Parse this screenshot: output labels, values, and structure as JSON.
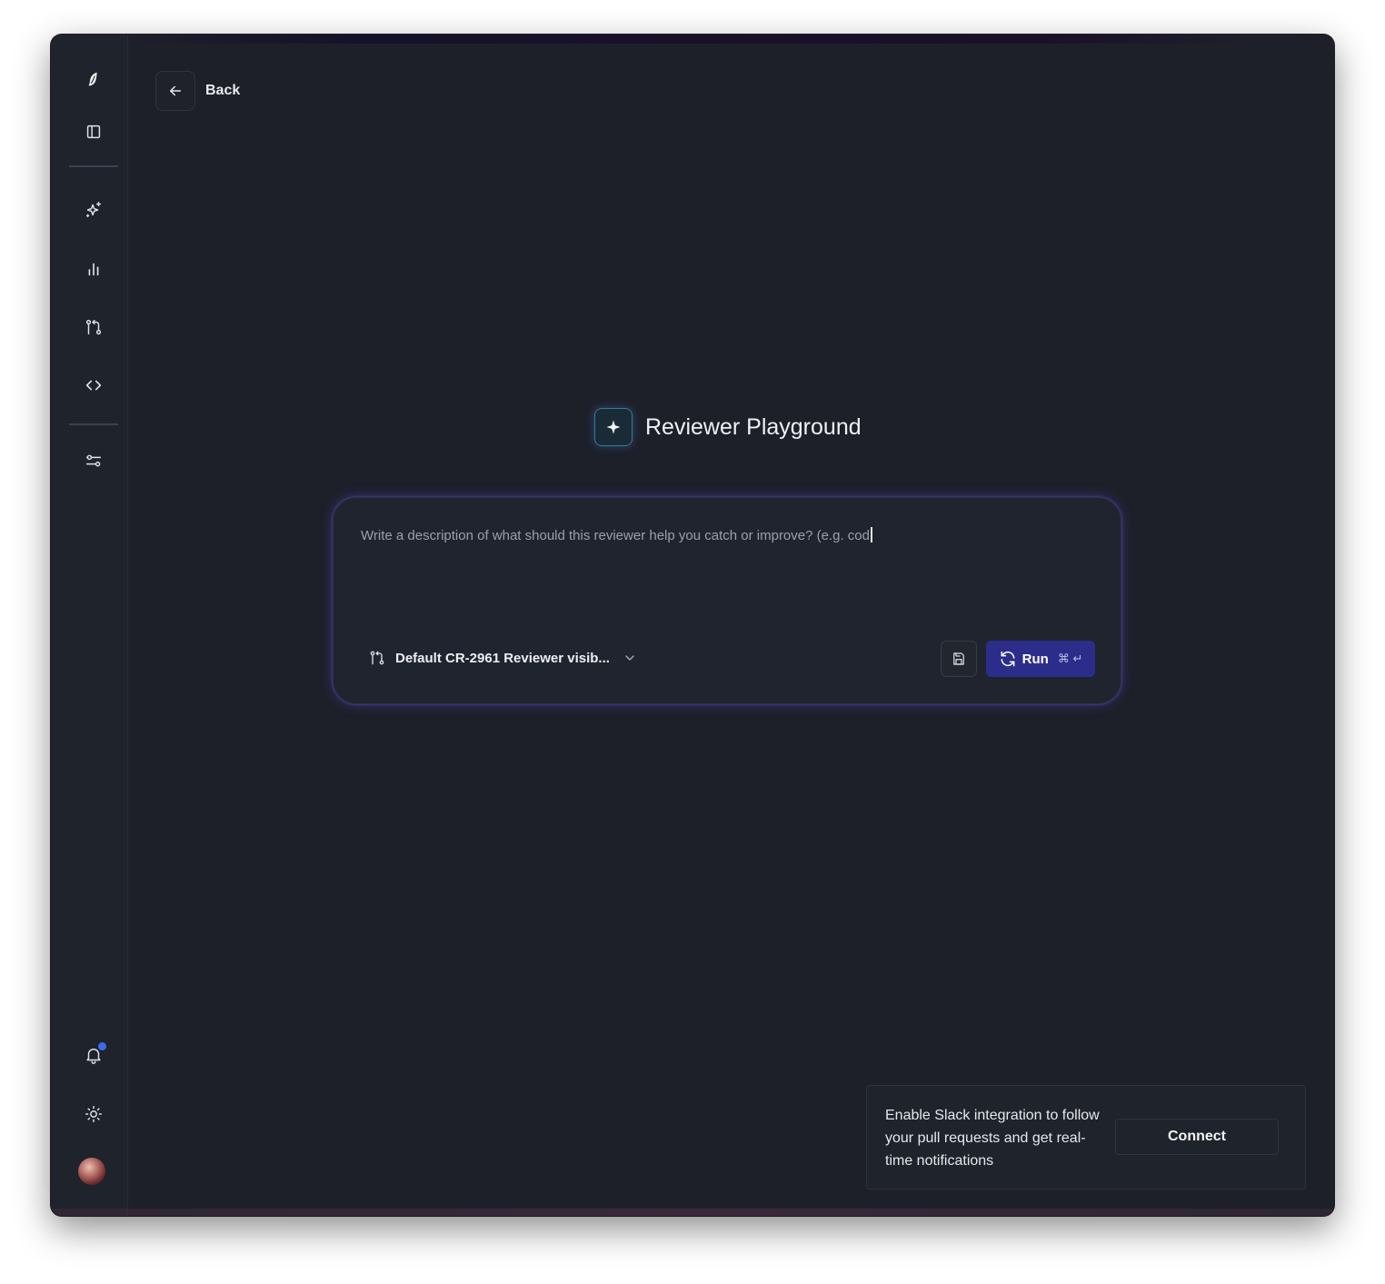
{
  "nav": {
    "back_label": "Back"
  },
  "sidebar": {
    "icons": [
      "logo-icon",
      "sidebar-toggle-icon",
      "sparkles-icon",
      "bar-chart-icon",
      "git-pull-request-icon",
      "code-icon",
      "sliders-icon",
      "bell-icon",
      "sun-icon"
    ]
  },
  "main": {
    "title": "Reviewer Playground",
    "prompt_text": "Write a description of what should this reviewer help you catch or improve? (e.g. cod",
    "reviewer_select": "Default CR-2961 Reviewer visib...",
    "run_label": "Run",
    "run_shortcut": "⌘ ↵"
  },
  "toast": {
    "message": "Enable Slack integration to follow your pull requests and get real-time notifications",
    "connect_label": "Connect"
  },
  "colors": {
    "background": "#1d2029",
    "sidebar": "#1f232c",
    "run_button": "#2c2d8a",
    "accent_glow": "#6e50ff",
    "notification_dot": "#3b6cf0"
  }
}
